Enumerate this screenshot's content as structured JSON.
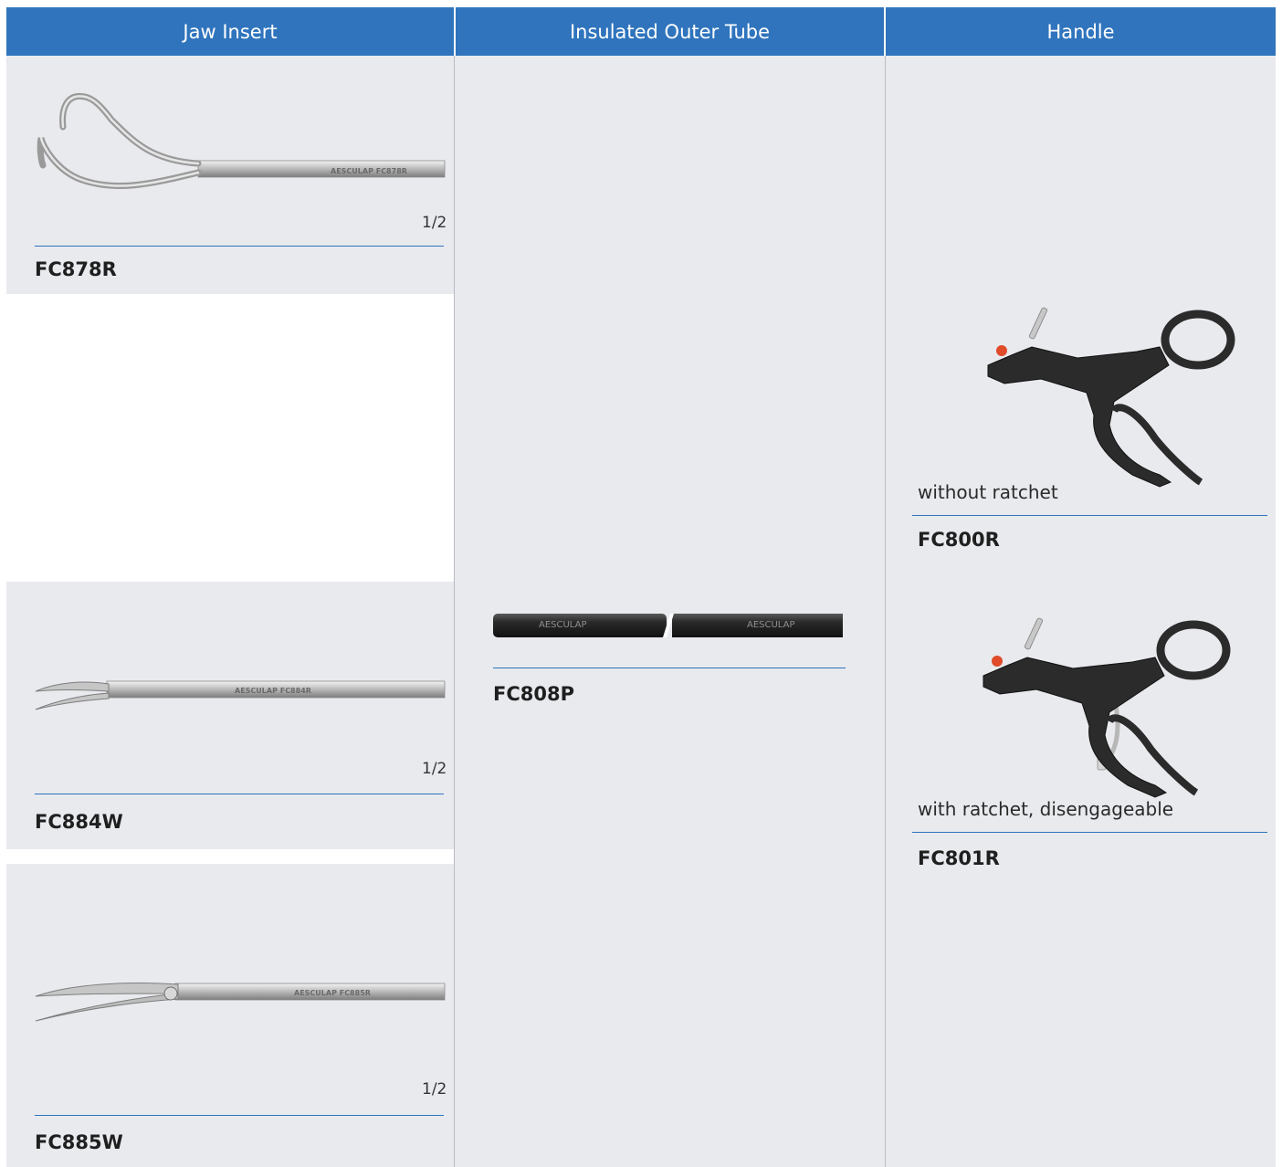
{
  "headers": {
    "jaw_insert": "Jaw Insert",
    "outer_tube": "Insulated Outer Tube",
    "handle": "Handle"
  },
  "jaw_inserts": [
    {
      "code": "FC878R",
      "scale": "1/2",
      "engraving": "AESCULAP FC878R"
    },
    {
      "code": "FC884W",
      "scale": "1/2",
      "engraving": "AESCULAP FC884R"
    },
    {
      "code": "FC885W",
      "scale": "1/2",
      "engraving": "AESCULAP FC885R"
    }
  ],
  "outer_tube": {
    "code": "FC808P",
    "engraving_left": "AESCULAP",
    "engraving_right": "AESCULAP"
  },
  "handles": [
    {
      "code": "FC800R",
      "description": "without ratchet"
    },
    {
      "code": "FC801R",
      "description": "with ratchet, disengageable"
    }
  ],
  "colors": {
    "header": "#2f74bd",
    "panel": "#e8eaee",
    "rule": "#2f74bd"
  }
}
